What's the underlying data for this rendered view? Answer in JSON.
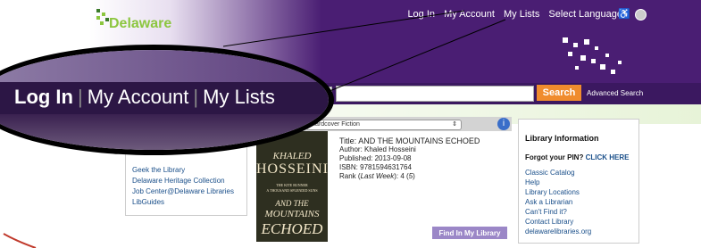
{
  "header": {
    "logo_text": "Delaware",
    "links": [
      "Log In",
      "My Account",
      "My Lists",
      "Select Language"
    ]
  },
  "magnifier": {
    "links": [
      "Log In",
      "My Account",
      "My Lists"
    ]
  },
  "search": {
    "button_label": "Search",
    "advanced_label": "Advanced Search"
  },
  "left_panel": {
    "links": [
      "Geek the Library",
      "Delaware Heritage Collection",
      "Job Center@Delaware Libraries",
      "LibGuides"
    ]
  },
  "book_list": {
    "selected_list": "Hardcover Fiction",
    "cover": {
      "author_line": "KHALED",
      "author_big": "HOSSEINI",
      "tagline1": "THE KITE RUNNER",
      "tagline2": "A THOUSAND SPLENDID SUNS",
      "title1": "AND THE",
      "title2": "MOUNTAINS",
      "title3": "ECHOED"
    },
    "title_label": "Title:",
    "title": "AND THE MOUNTAINS ECHOED",
    "author": "Author: Khaled Hosseini",
    "published": "Published: 2013-09-08",
    "isbn": "ISBN: 9781594631764",
    "rank_prefix": "Rank (",
    "rank_label": "Last Week",
    "rank_value": "): 4 (",
    "rank_weeks": "5",
    "rank_suffix": ")",
    "find_button": "Find In My Library"
  },
  "library_info": {
    "title": "Library Information",
    "pin_text": "Forgot your PIN?",
    "pin_link": "CLICK HERE",
    "links": [
      "Classic Catalog",
      "Help",
      "Library Locations",
      "Ask a Librarian",
      "Can't Find it?",
      "Contact Library",
      "delawarelibraries.org"
    ]
  },
  "colors": {
    "header_purple": "#4a1e73",
    "search_orange": "#f08c2e",
    "link_blue": "#1a4f8a",
    "logo_green": "#8cc63f",
    "find_button": "#9b87c7"
  }
}
